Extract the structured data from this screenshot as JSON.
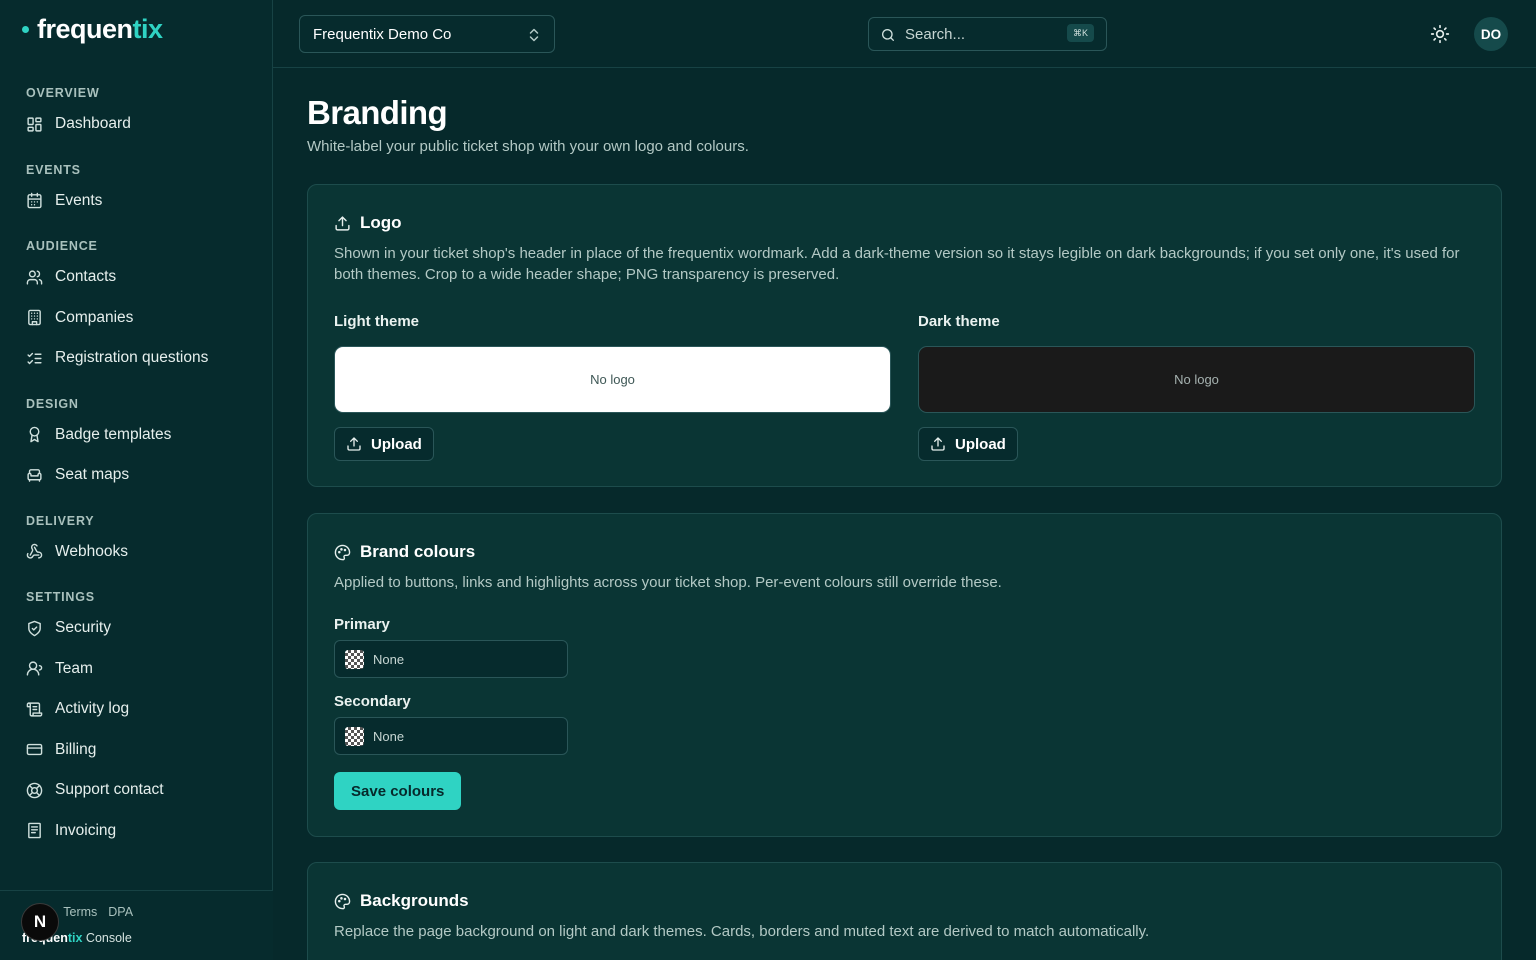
{
  "brand": {
    "name_main": "frequen",
    "name_accent": "tix"
  },
  "sidebar": {
    "sections": [
      {
        "heading": "OVERVIEW",
        "items": [
          {
            "label": "Dashboard",
            "icon": "dashboard-icon"
          }
        ]
      },
      {
        "heading": "EVENTS",
        "items": [
          {
            "label": "Events",
            "icon": "calendar-icon"
          }
        ]
      },
      {
        "heading": "AUDIENCE",
        "items": [
          {
            "label": "Contacts",
            "icon": "users-icon"
          },
          {
            "label": "Companies",
            "icon": "building-icon"
          },
          {
            "label": "Registration questions",
            "icon": "list-checks-icon"
          }
        ]
      },
      {
        "heading": "DESIGN",
        "items": [
          {
            "label": "Badge templates",
            "icon": "badge-icon"
          },
          {
            "label": "Seat maps",
            "icon": "armchair-icon"
          }
        ]
      },
      {
        "heading": "DELIVERY",
        "items": [
          {
            "label": "Webhooks",
            "icon": "webhook-icon"
          }
        ]
      },
      {
        "heading": "SETTINGS",
        "items": [
          {
            "label": "Security",
            "icon": "shield-icon"
          },
          {
            "label": "Team",
            "icon": "user-icon"
          },
          {
            "label": "Activity log",
            "icon": "log-icon"
          },
          {
            "label": "Billing",
            "icon": "credit-card-icon"
          },
          {
            "label": "Support contact",
            "icon": "lifebuoy-icon"
          },
          {
            "label": "Invoicing",
            "icon": "receipt-icon"
          }
        ]
      }
    ],
    "footer": {
      "links": [
        "y",
        "Terms",
        "DPA"
      ],
      "brand_main": "frequen",
      "brand_accent": "tix",
      "brand_suffix": " Console",
      "badge": "N"
    }
  },
  "topbar": {
    "org_name": "Frequentix Demo Co",
    "search_placeholder": "Search...",
    "search_shortcut": "⌘K",
    "avatar_initials": "DO"
  },
  "page": {
    "title": "Branding",
    "subtitle": "White-label your public ticket shop with your own logo and colours."
  },
  "logo_card": {
    "title": "Logo",
    "description": "Shown in your ticket shop's header in place of the frequentix wordmark. Add a dark-theme version so it stays legible on dark backgrounds; if you set only one, it's used for both themes. Crop to a wide header shape; PNG transparency is preserved.",
    "light_label": "Light theme",
    "dark_label": "Dark theme",
    "empty_text": "No logo",
    "upload_label": "Upload"
  },
  "colours_card": {
    "title": "Brand colours",
    "description": "Applied to buttons, links and highlights across your ticket shop. Per-event colours still override these.",
    "primary_label": "Primary",
    "primary_value": "None",
    "secondary_label": "Secondary",
    "secondary_value": "None",
    "save_label": "Save colours"
  },
  "backgrounds_card": {
    "title": "Backgrounds",
    "description": "Replace the page background on light and dark themes. Cards, borders and muted text are derived to match automatically."
  },
  "colors": {
    "accent": "#2fd3c3",
    "background": "#06292b",
    "card": "#0a3534"
  }
}
